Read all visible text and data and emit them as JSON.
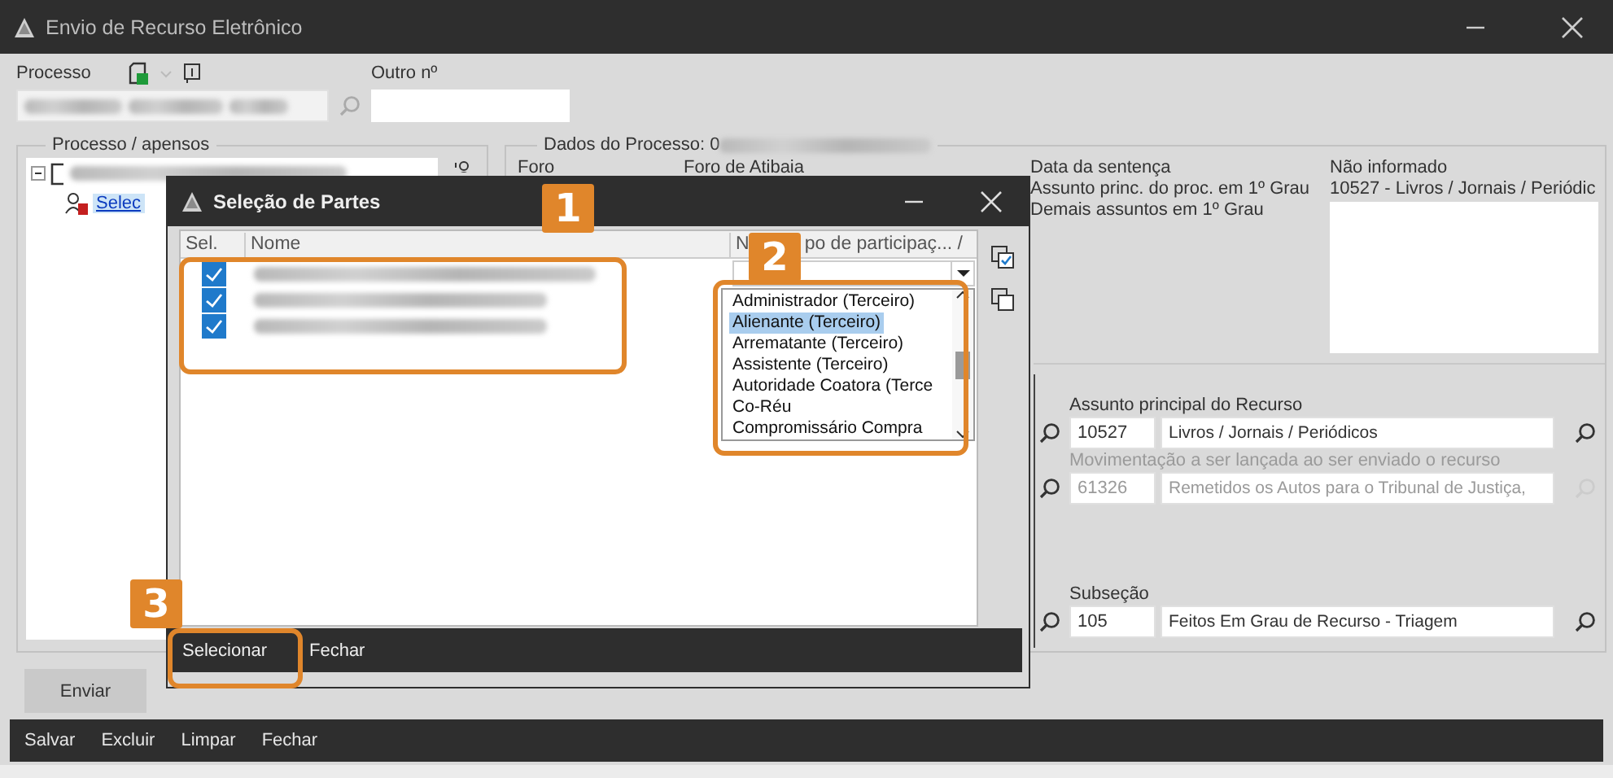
{
  "window": {
    "title": "Envio de Recurso Eletrônico"
  },
  "processo": {
    "label": "Processo",
    "outro_label": "Outro nº"
  },
  "apensos": {
    "title": "Processo / apensos",
    "root": {
      "expanded": true
    },
    "children": [
      {
        "label": "Selec",
        "selected": true
      }
    ]
  },
  "dados": {
    "title": "Dados do Processo: 0",
    "foro_label": "Foro",
    "foro_value": "Foro de Atibaia",
    "info": [
      {
        "label": "Data da sentença",
        "value": "Não informado"
      },
      {
        "label": "Assunto princ. do proc. em 1º Grau",
        "value": "10527 - Livros / Jornais / Periódic"
      },
      {
        "label": "Demais assuntos em 1º Grau"
      }
    ]
  },
  "recurso": [
    {
      "label": "Assunto principal do Recurso",
      "code": "10527",
      "description": "Livros / Jornais / Periódicos",
      "disabled": false
    },
    {
      "label": "Movimentação a ser lançada ao ser enviado o recurso",
      "code": "61326",
      "description": "Remetidos os Autos para o Tribunal de Justiça,",
      "disabled": true
    },
    {
      "label": "Subseção",
      "code": "105",
      "description": "Feitos Em Grau de Recurso - Triagem",
      "disabled": false
    }
  ],
  "send_button": "Enviar",
  "toolbar": [
    "Salvar",
    "Excluir",
    "Limpar",
    "Fechar"
  ],
  "dialog": {
    "title": "Seleção de Partes",
    "columns": [
      "Sel.",
      "Nome"
    ],
    "column_3_start": "N",
    "column_3_end": "po de participaç... /",
    "rows": [
      {
        "checked": true
      },
      {
        "checked": true
      },
      {
        "checked": true
      }
    ],
    "dropdown": [
      {
        "label": "Administrador (Terceiro)",
        "selected": false
      },
      {
        "label": "Alienante (Terceiro)",
        "selected": true
      },
      {
        "label": "Arrematante (Terceiro)",
        "selected": false
      },
      {
        "label": "Assistente (Terceiro)",
        "selected": false
      },
      {
        "label": "Autoridade Coatora (Terce",
        "selected": false
      },
      {
        "label": "Co-Réu",
        "selected": false
      },
      {
        "label": "Compromissário Compra",
        "selected": false
      }
    ],
    "buttons": [
      "Selecionar",
      "Fechar"
    ]
  },
  "callouts": [
    "1",
    "2",
    "3"
  ]
}
